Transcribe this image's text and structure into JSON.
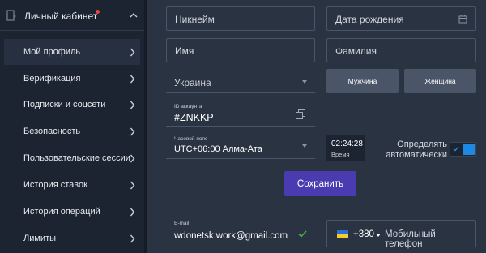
{
  "sidebar": {
    "title": "Личный кабинет",
    "items": [
      {
        "label": "Мой профиль",
        "active": true
      },
      {
        "label": "Верификация"
      },
      {
        "label": "Подписки и соцсети"
      },
      {
        "label": "Безопасность"
      },
      {
        "label": "Пользовательские сессии"
      },
      {
        "label": "История ставок"
      },
      {
        "label": "История операций"
      },
      {
        "label": "Лимиты"
      }
    ]
  },
  "form": {
    "nickname_placeholder": "Никнейм",
    "birthdate_placeholder": "Дата рождения",
    "name_placeholder": "Имя",
    "surname_placeholder": "Фамилия",
    "country_value": "Украина",
    "gender_male": "Мужчина",
    "gender_female": "Женщина",
    "account_id_label": "ID аккаунта",
    "account_id_value": "#ZNKKP",
    "timezone_label": "Часовой пояс",
    "timezone_value": "UTC+06:00 Алма-Ата",
    "time_value": "02:24:28",
    "time_label": "Время",
    "auto_detect_line1": "Определять",
    "auto_detect_line2": "автоматически",
    "auto_detect_enabled": true,
    "save_label": "Сохранить",
    "email_label": "E-mail",
    "email_value": "wdonetsk.work@gmail.com",
    "phone_code": "+380",
    "phone_placeholder": "Мобильный телефон"
  },
  "colors": {
    "background": "#2a3342",
    "sidebar": "#1c2431",
    "accent_button": "#4b3bb0",
    "toggle_on": "#1e88e5",
    "notification_dot": "#e8423a",
    "email_check": "#4caf50"
  }
}
